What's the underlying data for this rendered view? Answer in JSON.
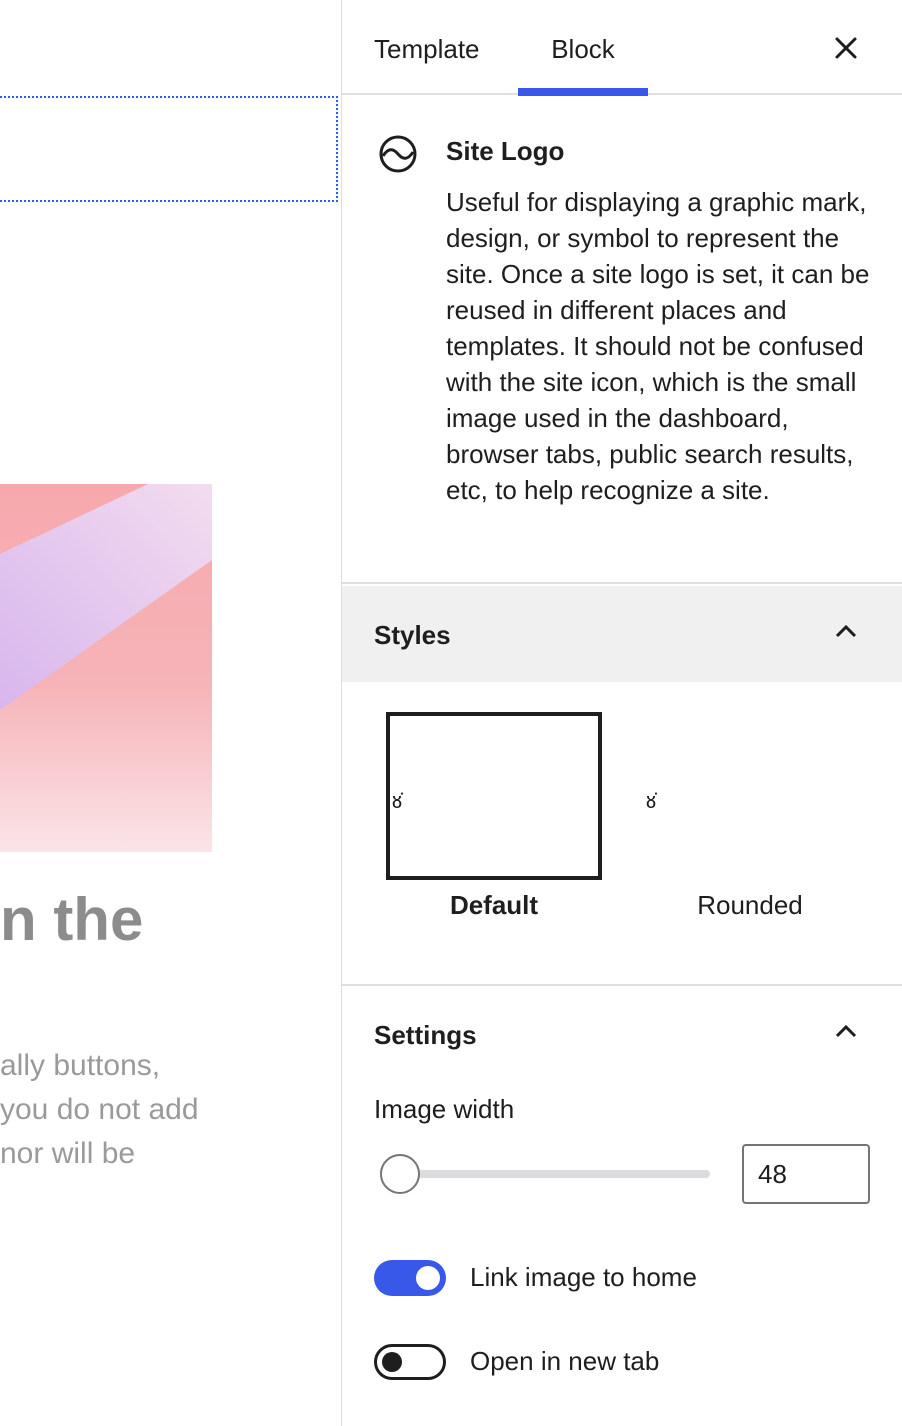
{
  "canvas": {
    "heading_fragment": "n the",
    "paragraph_lines": [
      "ally buttons,",
      "you do not add",
      "nor will be"
    ]
  },
  "tabs": {
    "template_label": "Template",
    "block_label": "Block",
    "active": "Block"
  },
  "block_card": {
    "title": "Site Logo",
    "icon": "site-logo-icon",
    "description": "Useful for displaying a graphic mark, design, or symbol to represent the site. Once a site logo is set, it can be reused in different places and templates. It should not be confused with the site icon, which is the small image used in the dashboard, browser tabs, public search results, etc, to help recognize a site."
  },
  "styles": {
    "title": "Styles",
    "expanded": true,
    "options": [
      {
        "label": "Default",
        "selected": true
      },
      {
        "label": "Rounded",
        "selected": false
      }
    ]
  },
  "settings": {
    "title": "Settings",
    "expanded": true,
    "image_width": {
      "label": "Image width",
      "value": "48"
    },
    "link_to_home": {
      "label": "Link image to home",
      "checked": true
    },
    "open_new_tab": {
      "label": "Open in new tab",
      "checked": false
    }
  },
  "colors": {
    "accent": "#3858e9",
    "text": "#1e1e1e",
    "panel_header_bg": "#f0f0f0"
  }
}
